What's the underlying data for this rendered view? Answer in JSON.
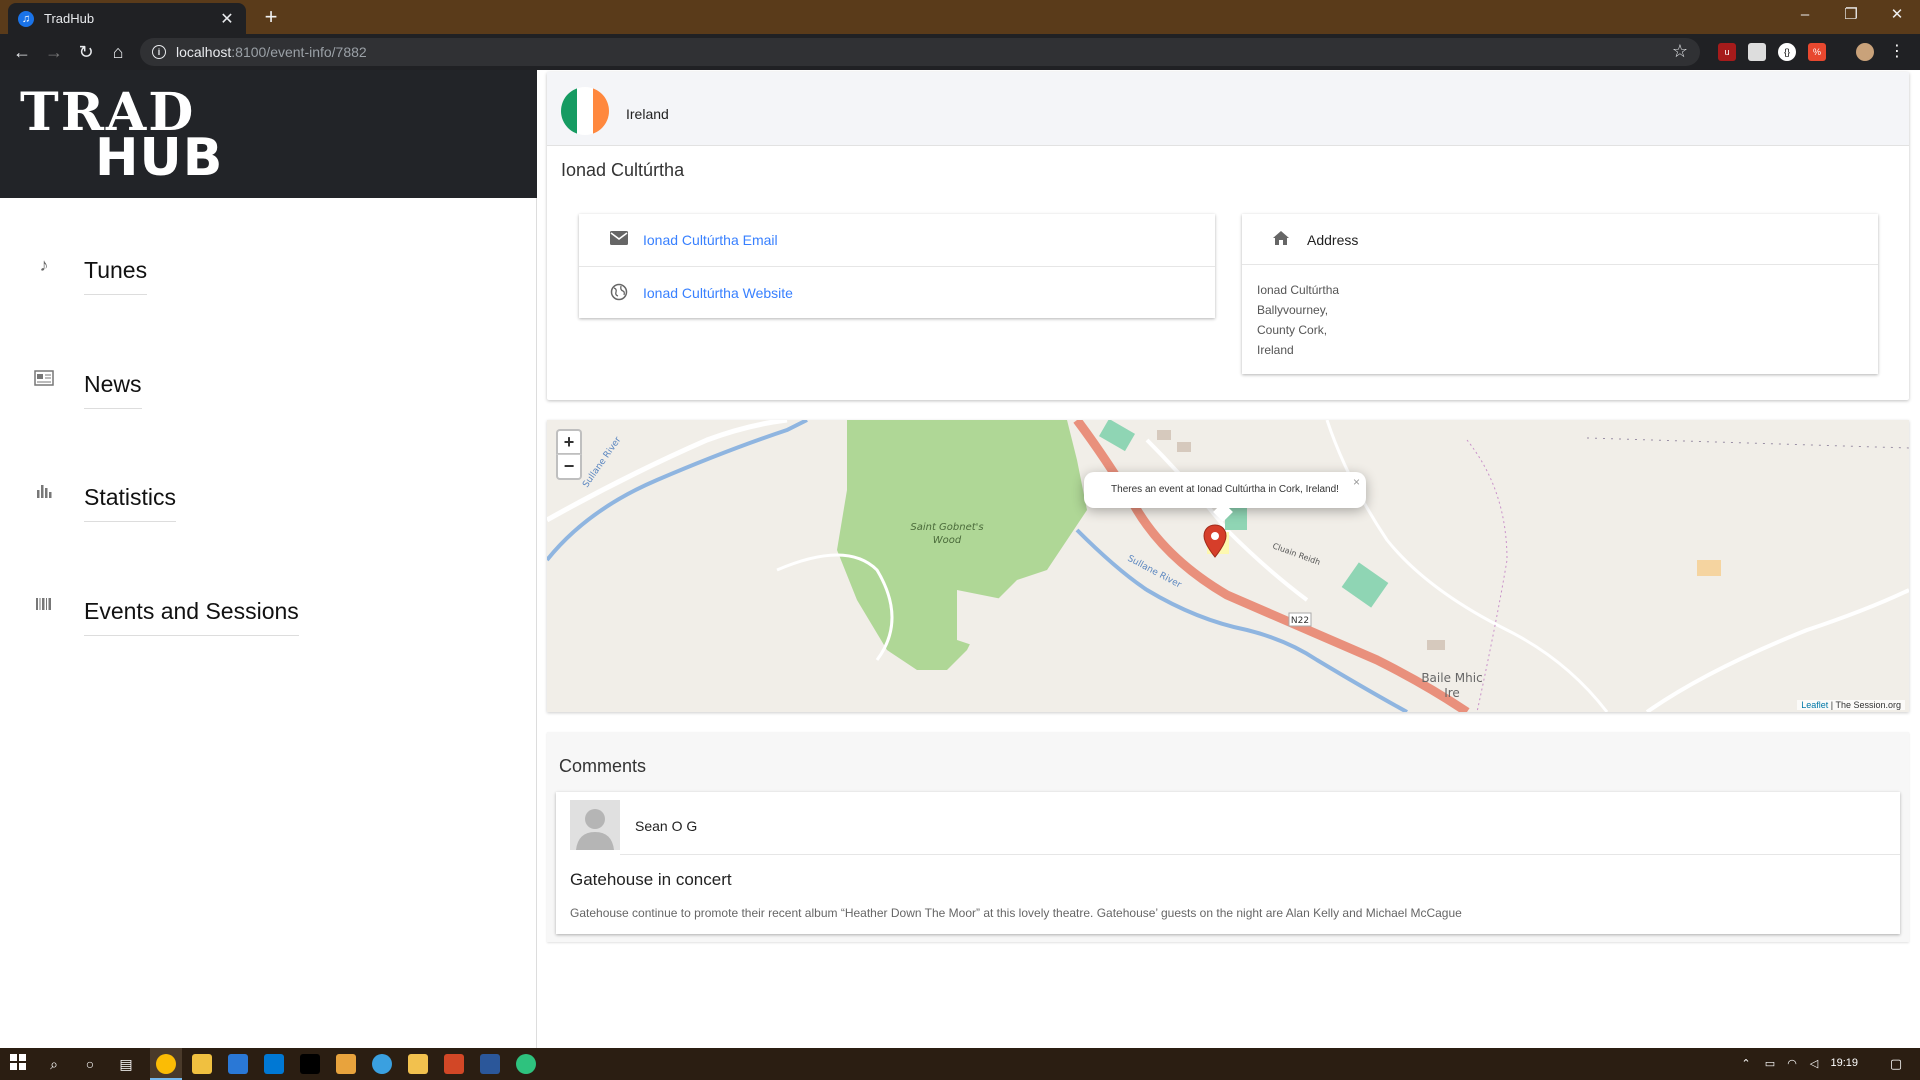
{
  "browser": {
    "tab_title": "TradHub",
    "url_host": "localhost",
    "url_path": ":8100/event-info/7882",
    "window_minimize": "–",
    "window_restore": "❐",
    "window_close": "✕"
  },
  "app": {
    "logo_line1": "TRAD",
    "logo_line2": "HUB",
    "nav": [
      {
        "label": "Tunes",
        "icon": "music-note-icon"
      },
      {
        "label": "News",
        "icon": "newspaper-icon"
      },
      {
        "label": "Statistics",
        "icon": "bar-chart-icon"
      },
      {
        "label": "Events and Sessions",
        "icon": "barcode-icon"
      }
    ]
  },
  "venue": {
    "country": "Ireland",
    "name": "Ionad Cultúrtha",
    "email_link": "Ionad Cultúrtha Email",
    "website_link": "Ionad Cultúrtha Website",
    "address_title": "Address",
    "address_lines": [
      "Ionad Cultúrtha",
      "Ballyvourney,",
      "County Cork,",
      "Ireland"
    ],
    "flag_colors": [
      "#169b62",
      "#ffffff",
      "#ff883e"
    ]
  },
  "map": {
    "zoom_in": "+",
    "zoom_out": "−",
    "popup_text": "Theres an event at Ionad Cultúrtha in Cork, Ireland!",
    "popup_close": "×",
    "attribution_leaflet": "Leaflet",
    "attribution_source": " | The Session.org",
    "labels": {
      "wood": [
        "Saint Gobnet's",
        "Wood"
      ],
      "river1": "Sullane River",
      "river2": "Sullane River",
      "road": "N22",
      "street": "Cluain Reidh",
      "town": [
        "Baile Mhic",
        "Ire"
      ]
    }
  },
  "comments": {
    "title": "Comments",
    "items": [
      {
        "author": "Sean O G",
        "title": "Gatehouse in concert",
        "body": "Gatehouse continue to promote their recent album “Heather Down The Moor” at this lovely theatre. Gatehouse’ guests on the night are Alan Kelly and Michael McCague"
      }
    ]
  },
  "taskbar": {
    "time": "19:19"
  }
}
